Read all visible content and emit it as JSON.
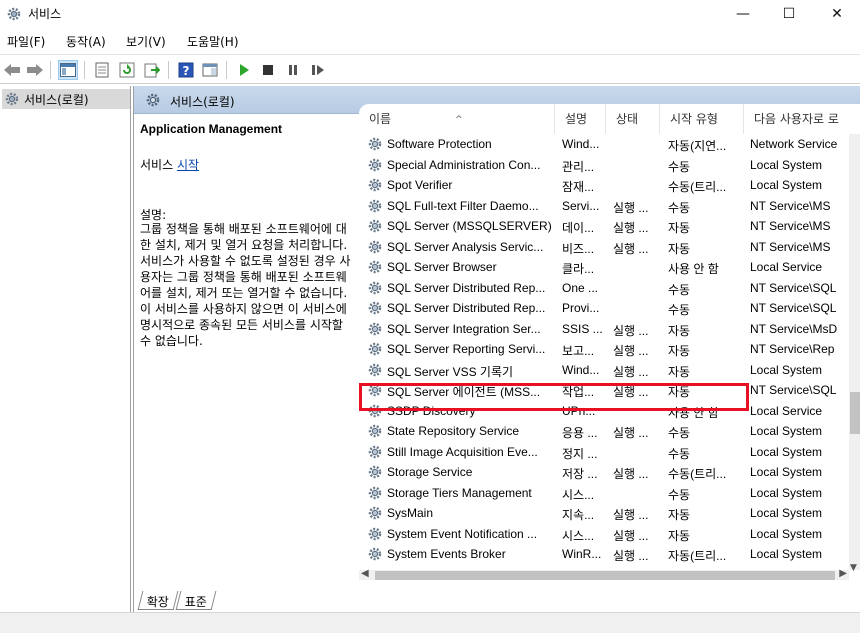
{
  "window": {
    "title": "서비스",
    "minimize": "—",
    "maximize": "☐",
    "close": "✕"
  },
  "menu": [
    "파일(F)",
    "동작(A)",
    "보기(V)",
    "도움말(H)"
  ],
  "tree": {
    "root_label": "서비스(로컬)"
  },
  "content_header": {
    "title": "서비스(로컬)"
  },
  "detail": {
    "service_name": "Application Management",
    "start_prefix": "서비스 ",
    "start_link": "시작",
    "desc_label": "설명:",
    "desc_text": "그룹 정책을 통해 배포된 소프트웨어에 대한 설치, 제거 및 열거 요청을 처리합니다. 서비스가 사용할 수 없도록 설정된 경우 사용자는 그룹 정책을 통해 배포된 소프트웨어를 설치, 제거 또는 열거할 수 없습니다. 이 서비스를 사용하지 않으면 이 서비스에 명시적으로 종속된 모든 서비스를 시작할 수 없습니다."
  },
  "columns": [
    "이름",
    "설명",
    "상태",
    "시작 유형",
    "다음 사용자로 로"
  ],
  "rows": [
    {
      "name": "Software Protection",
      "desc": "Wind...",
      "status": "",
      "type": "자동(지연...",
      "logon": "Network Service"
    },
    {
      "name": "Special Administration Con...",
      "desc": "관리...",
      "status": "",
      "type": "수동",
      "logon": "Local System"
    },
    {
      "name": "Spot Verifier",
      "desc": "잠재...",
      "status": "",
      "type": "수동(트리...",
      "logon": "Local System"
    },
    {
      "name": "SQL Full-text Filter Daemo...",
      "desc": "Servi...",
      "status": "실행 ...",
      "type": "수동",
      "logon": "NT Service\\MS"
    },
    {
      "name": "SQL Server (MSSQLSERVER)",
      "desc": "데이...",
      "status": "실행 ...",
      "type": "자동",
      "logon": "NT Service\\MS"
    },
    {
      "name": "SQL Server Analysis Servic...",
      "desc": "비즈...",
      "status": "실행 ...",
      "type": "자동",
      "logon": "NT Service\\MS"
    },
    {
      "name": "SQL Server Browser",
      "desc": "클라...",
      "status": "",
      "type": "사용 안 함",
      "logon": "Local Service"
    },
    {
      "name": "SQL Server Distributed Rep...",
      "desc": "One ...",
      "status": "",
      "type": "수동",
      "logon": "NT Service\\SQL"
    },
    {
      "name": "SQL Server Distributed Rep...",
      "desc": "Provi...",
      "status": "",
      "type": "수동",
      "logon": "NT Service\\SQL"
    },
    {
      "name": "SQL Server Integration Ser...",
      "desc": "SSIS ...",
      "status": "실행 ...",
      "type": "자동",
      "logon": "NT Service\\MsD"
    },
    {
      "name": "SQL Server Reporting Servi...",
      "desc": "보고...",
      "status": "실행 ...",
      "type": "자동",
      "logon": "NT Service\\Rep"
    },
    {
      "name": "SQL Server VSS 기록기",
      "desc": "Wind...",
      "status": "실행 ...",
      "type": "자동",
      "logon": "Local System"
    },
    {
      "name": "SQL Server 에이전트 (MSS...",
      "desc": "작업...",
      "status": "실행 ...",
      "type": "자동",
      "logon": "NT Service\\SQL"
    },
    {
      "name": "SSDP Discovery",
      "desc": "UPn...",
      "status": "",
      "type": "사용 안 함",
      "logon": "Local Service"
    },
    {
      "name": "State Repository Service",
      "desc": "응용 ...",
      "status": "실행 ...",
      "type": "수동",
      "logon": "Local System"
    },
    {
      "name": "Still Image Acquisition Eve...",
      "desc": "정지 ...",
      "status": "",
      "type": "수동",
      "logon": "Local System"
    },
    {
      "name": "Storage Service",
      "desc": "저장 ...",
      "status": "실행 ...",
      "type": "수동(트리...",
      "logon": "Local System"
    },
    {
      "name": "Storage Tiers Management",
      "desc": "시스...",
      "status": "",
      "type": "수동",
      "logon": "Local System"
    },
    {
      "name": "SysMain",
      "desc": "지속...",
      "status": "실행 ...",
      "type": "자동",
      "logon": "Local System"
    },
    {
      "name": "System Event Notification ...",
      "desc": "시스...",
      "status": "실행 ...",
      "type": "자동",
      "logon": "Local System"
    },
    {
      "name": "System Events Broker",
      "desc": "WinR...",
      "status": "실행 ...",
      "type": "자동(트리...",
      "logon": "Local System"
    }
  ],
  "tabs": [
    "확장",
    "표준"
  ],
  "accent_highlight": "#e81123"
}
